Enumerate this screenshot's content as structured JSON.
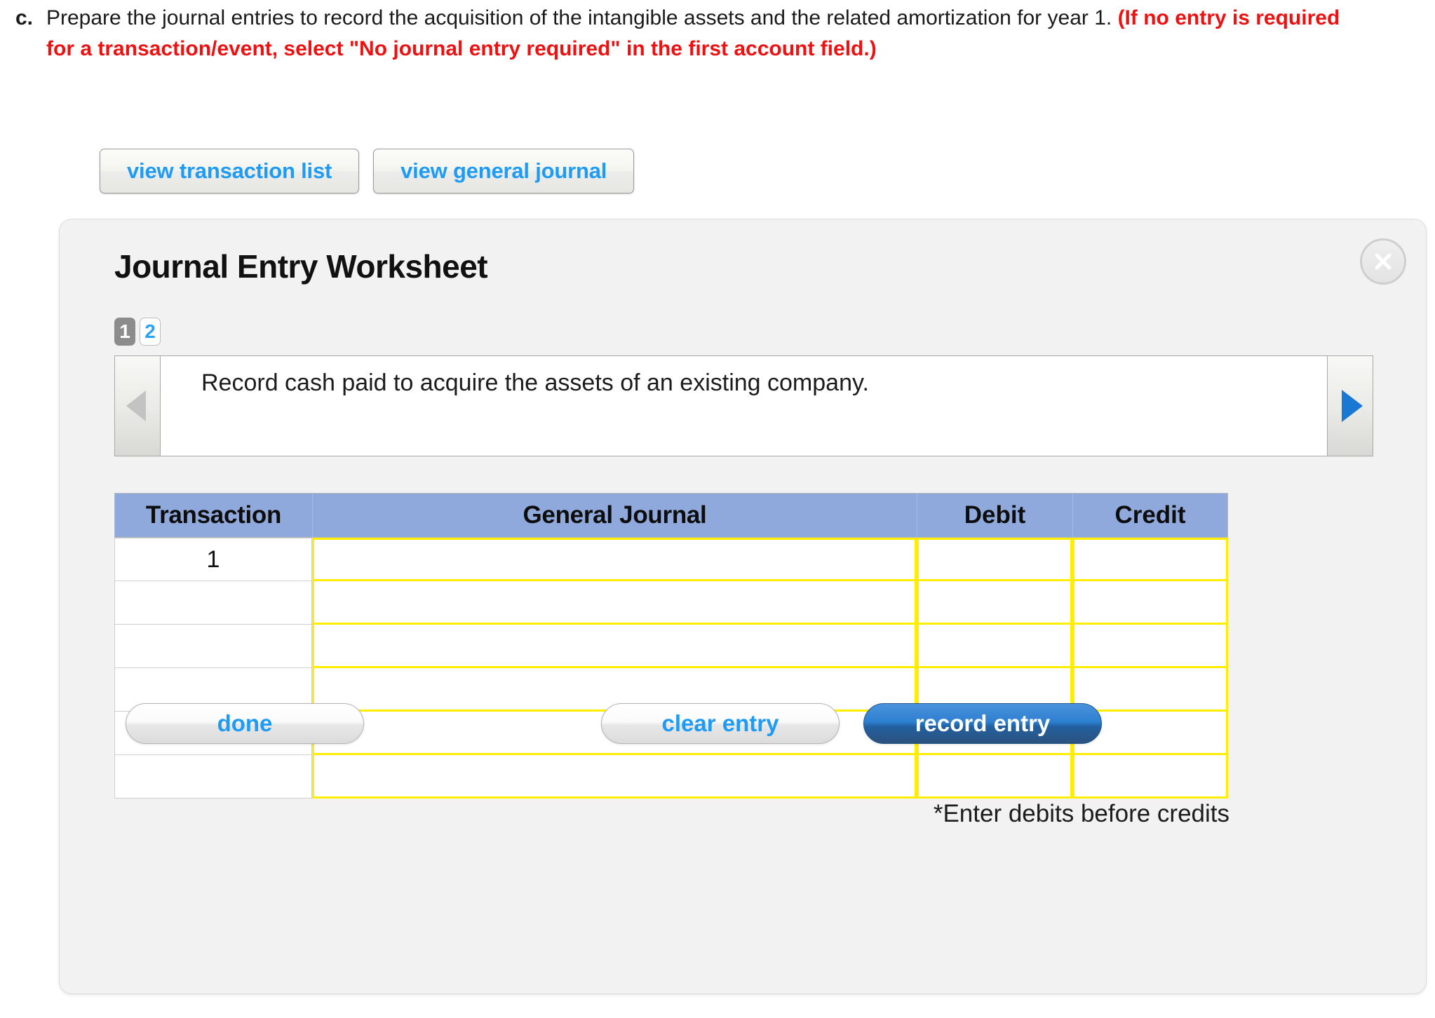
{
  "prompt": {
    "letter": "c.",
    "text_black_1": "Prepare the journal entries to record the acquisition of the intangible assets and the related amortization for year 1. ",
    "text_red": "(If no entry is required for a transaction/event, select \"No journal entry required\" in the first account field.)"
  },
  "toolbar": {
    "view_transaction_list": "view transaction list",
    "view_general_journal": "view general journal"
  },
  "worksheet": {
    "title": "Journal Entry Worksheet",
    "close_label": "X",
    "tabs": [
      {
        "label": "1",
        "active": true
      },
      {
        "label": "2",
        "active": false
      }
    ],
    "description": "Record cash paid to acquire the assets of an existing company.",
    "prev_arrow": "prev-arrow",
    "next_arrow": "next-arrow",
    "footnote": "*Enter debits before credits"
  },
  "table": {
    "headers": [
      "Transaction",
      "General Journal",
      "Debit",
      "Credit"
    ],
    "rows": [
      {
        "transaction": "1",
        "general_journal": "",
        "debit": "",
        "credit": ""
      },
      {
        "transaction": "",
        "general_journal": "",
        "debit": "",
        "credit": ""
      },
      {
        "transaction": "",
        "general_journal": "",
        "debit": "",
        "credit": ""
      },
      {
        "transaction": "",
        "general_journal": "",
        "debit": "",
        "credit": ""
      },
      {
        "transaction": "",
        "general_journal": "",
        "debit": "",
        "credit": ""
      },
      {
        "transaction": "",
        "general_journal": "",
        "debit": "",
        "credit": ""
      }
    ]
  },
  "actions": {
    "done": "done",
    "clear_entry": "clear entry",
    "record_entry": "record entry"
  },
  "colors": {
    "link_blue": "#1e9bf5",
    "alert_red": "#ee1111",
    "header_blue": "#90a9dd",
    "input_border_yellow": "#ffee00",
    "record_blue": "#2d7fd0",
    "panel_bg": "#f2f2f2"
  }
}
